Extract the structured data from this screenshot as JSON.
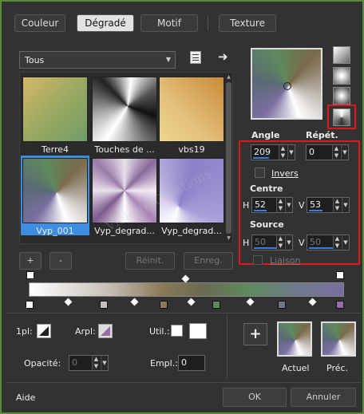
{
  "tabs": [
    {
      "label": "Couleur"
    },
    {
      "label": "Dégradé"
    },
    {
      "label": "Motif"
    },
    {
      "label": "Texture"
    }
  ],
  "selected_tab": "Dégradé",
  "category": {
    "value": "Tous"
  },
  "thumbnails": [
    {
      "name": "Terre4"
    },
    {
      "name": "Touches de ..."
    },
    {
      "name": "vbs19"
    },
    {
      "name": "Vyp_001"
    },
    {
      "name": "Vyp_degrad..."
    },
    {
      "name": "Vyp_degrad..."
    }
  ],
  "buttons": {
    "add": "+",
    "remove": "-",
    "reset": "Réinit.",
    "save": "Enreg.",
    "ok": "OK",
    "cancel": "Annuler",
    "help": "Aide",
    "add_swatch": "+"
  },
  "angle": {
    "label": "Angle",
    "value": "209",
    "fill_fraction": 0.58
  },
  "repeat": {
    "label": "Répét.",
    "value": "0",
    "fill_fraction": 0.0
  },
  "invert": {
    "label": "Invers",
    "checked": false
  },
  "center": {
    "label": "Centre",
    "h_label": "H",
    "h_value": "52",
    "v_label": "V",
    "v_value": "53",
    "h_fraction": 0.52,
    "v_fraction": 0.53
  },
  "source": {
    "label": "Source",
    "h_label": "H",
    "h_value": "50",
    "v_label": "V",
    "v_value": "50"
  },
  "link": {
    "label": "Liaison"
  },
  "bottom": {
    "first_label": "1pl:",
    "arpl_label": "Arpl:",
    "util_label": "Util.:",
    "opacity_label": "Opacité:",
    "opacity_value": "0",
    "empl_label": "Empl.:",
    "empl_value": "0",
    "current_label": "Actuel",
    "previous_label": "Préc."
  },
  "watermark": "Violette Creations",
  "colors": {
    "accent": "#3a7dd8",
    "highlight": "#e01818",
    "frame": "#5a8a3a"
  }
}
